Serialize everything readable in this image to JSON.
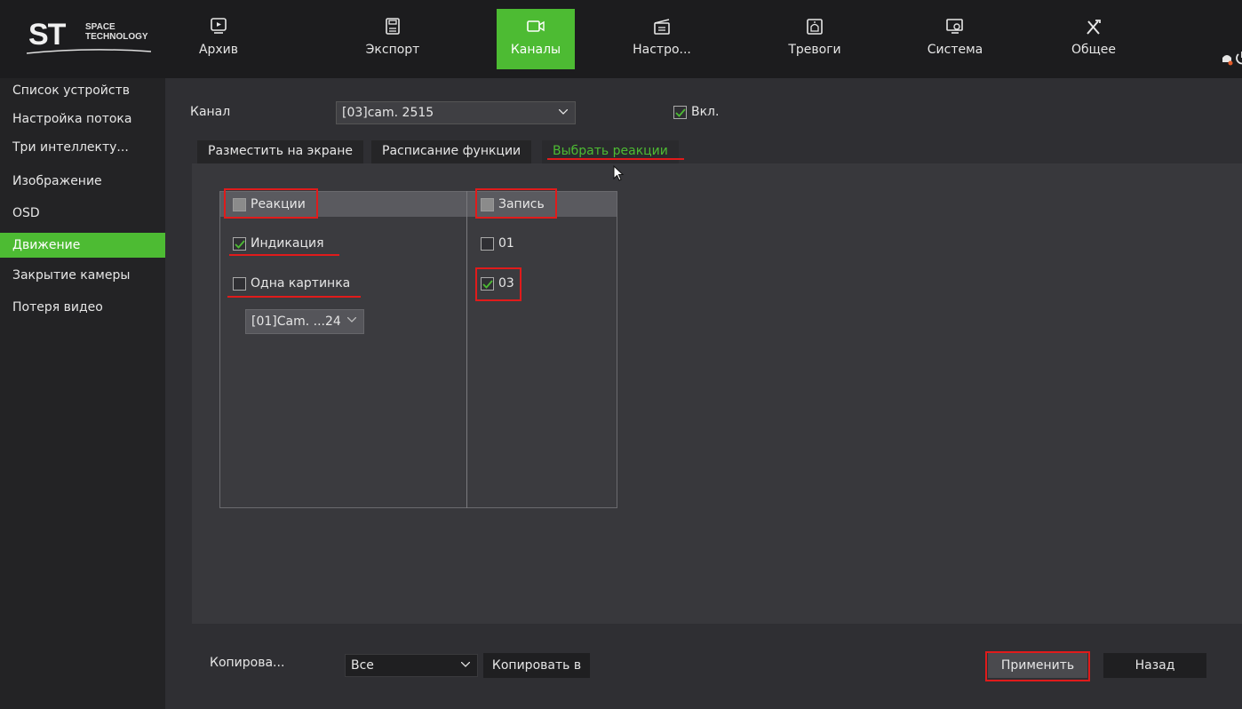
{
  "logo": {
    "mark": "ST",
    "subtitle_line1": "SPACE",
    "subtitle_line2": "TECHNOLOGY"
  },
  "nav": [
    {
      "label": "Архив",
      "icon": "archive-play-icon"
    },
    {
      "label": "Экспорт",
      "icon": "floppy-disk-icon"
    },
    {
      "label": "Каналы",
      "icon": "camera-icon",
      "active": true
    },
    {
      "label": "Настро...",
      "icon": "clapperboard-icon"
    },
    {
      "label": "Тревоги",
      "icon": "siren-icon"
    },
    {
      "label": "Система",
      "icon": "monitor-gear-icon"
    },
    {
      "label": "Общее",
      "icon": "tools-icon"
    }
  ],
  "sidebar": {
    "items": [
      {
        "label": "Список устройств"
      },
      {
        "label": "Настройка потока"
      },
      {
        "label": "Три интеллекту..."
      },
      {
        "label": "Изображение"
      },
      {
        "label": "OSD"
      },
      {
        "label": "Движение",
        "active": true
      },
      {
        "label": "Закрытие камеры"
      },
      {
        "label": "Потеря видео"
      }
    ]
  },
  "channel": {
    "label": "Канал",
    "value": "[03]cam. 2515",
    "enable_label": "Вкл.",
    "enabled": true
  },
  "tabs": [
    {
      "label": "Разместить на экране"
    },
    {
      "label": "Расписание функции"
    },
    {
      "label": "Выбрать реакции",
      "active": true
    }
  ],
  "reactions": {
    "header": "Реакции",
    "header_checked": false,
    "items": [
      {
        "label": "Индикация",
        "checked": true
      },
      {
        "label": "Одна картинка",
        "checked": false
      }
    ],
    "picture_select": "[01]Cam. ...24"
  },
  "record": {
    "header": "Запись",
    "header_checked": false,
    "items": [
      {
        "label": "01",
        "checked": false
      },
      {
        "label": "03",
        "checked": true
      }
    ]
  },
  "footer": {
    "copy_label": "Копирова...",
    "copy_select": "Все",
    "copy_to_button": "Копировать в",
    "apply_button": "Применить",
    "back_button": "Назад"
  },
  "colors": {
    "accent": "#4dbb33",
    "annotation": "#e01b1b"
  }
}
